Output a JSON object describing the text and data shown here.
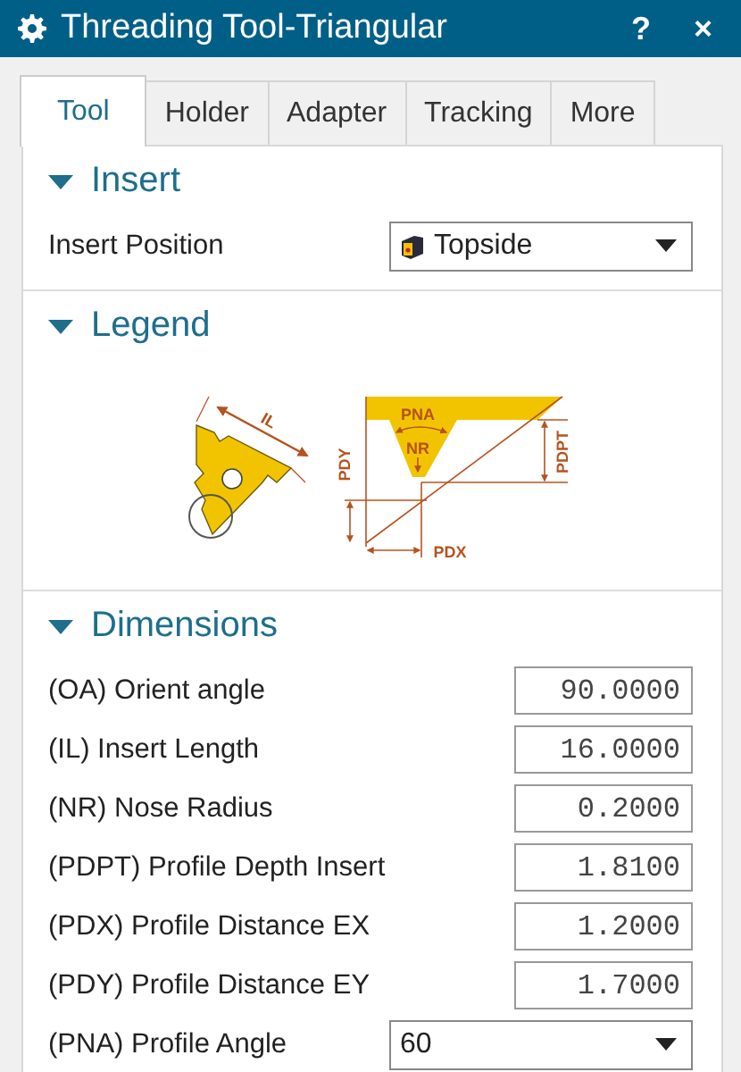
{
  "window": {
    "title": "Threading Tool-Triangular",
    "buttons": [
      "?",
      "×"
    ]
  },
  "tabs": [
    {
      "label": "Tool",
      "selected": true
    },
    {
      "label": "Holder",
      "selected": false
    },
    {
      "label": "Adapter",
      "selected": false
    },
    {
      "label": "Tracking",
      "selected": false
    },
    {
      "label": "More",
      "selected": false
    }
  ],
  "sections": [
    {
      "title": "Insert",
      "expanded": true,
      "kind": "fields",
      "fields": [
        {
          "kind": "dropdown",
          "label": "Insert Position",
          "value": "Topside",
          "icon": true
        }
      ]
    },
    {
      "title": "Legend",
      "expanded": true,
      "kind": "legend",
      "labels": [
        "IL",
        "PNA",
        "NR",
        "PDY",
        "PDPT",
        "PDX"
      ]
    },
    {
      "title": "Dimensions",
      "expanded": true,
      "kind": "fields",
      "fields": [
        {
          "kind": "number",
          "label": "(OA) Orient angle",
          "value": "90.0000"
        },
        {
          "kind": "number",
          "label": "(IL) Insert Length",
          "value": "16.0000"
        },
        {
          "kind": "number",
          "label": "(NR) Nose Radius",
          "value": "0.2000"
        },
        {
          "kind": "number",
          "label": "(PDPT) Profile Depth Insert",
          "value": "1.8100"
        },
        {
          "kind": "number",
          "label": "(PDX) Profile Distance EX",
          "value": "1.2000"
        },
        {
          "kind": "number",
          "label": "(PDY) Profile Distance EY",
          "value": "1.7000"
        },
        {
          "kind": "dropdown",
          "label": "(PNA) Profile Angle",
          "value": "60",
          "icon": false
        }
      ]
    }
  ]
}
